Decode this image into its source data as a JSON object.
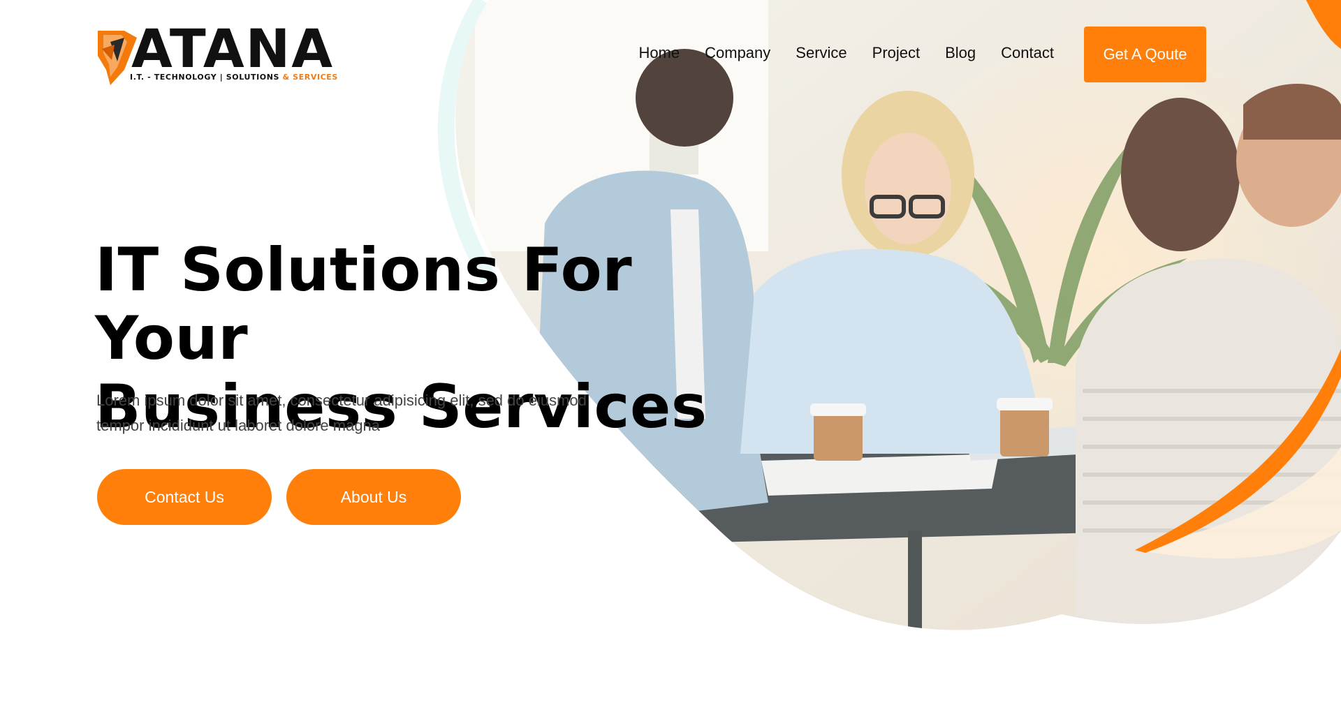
{
  "brand": {
    "name": "ATANA",
    "tagline_main": "I.T. - TECHNOLOGY | SOLUTIONS ",
    "tagline_accent": "& SERVICES",
    "accent_color": "#ff7f0a"
  },
  "nav": {
    "items": [
      "Home",
      "Company",
      "Service",
      "Project",
      "Blog",
      "Contact"
    ],
    "quote_label": "Get A Qoute"
  },
  "hero": {
    "headline_line1": "IT Solutions For Your",
    "headline_line2": "Business Services",
    "lead": "Lorem ipsum dolor sit amet, consectetur adipisicing elit, sed do eiusmod tempor incididunt ut laboret dolore magna",
    "contact_label": "Contact Us",
    "about_label": "About Us"
  },
  "icons": [
    "logo-emblem-icon"
  ]
}
